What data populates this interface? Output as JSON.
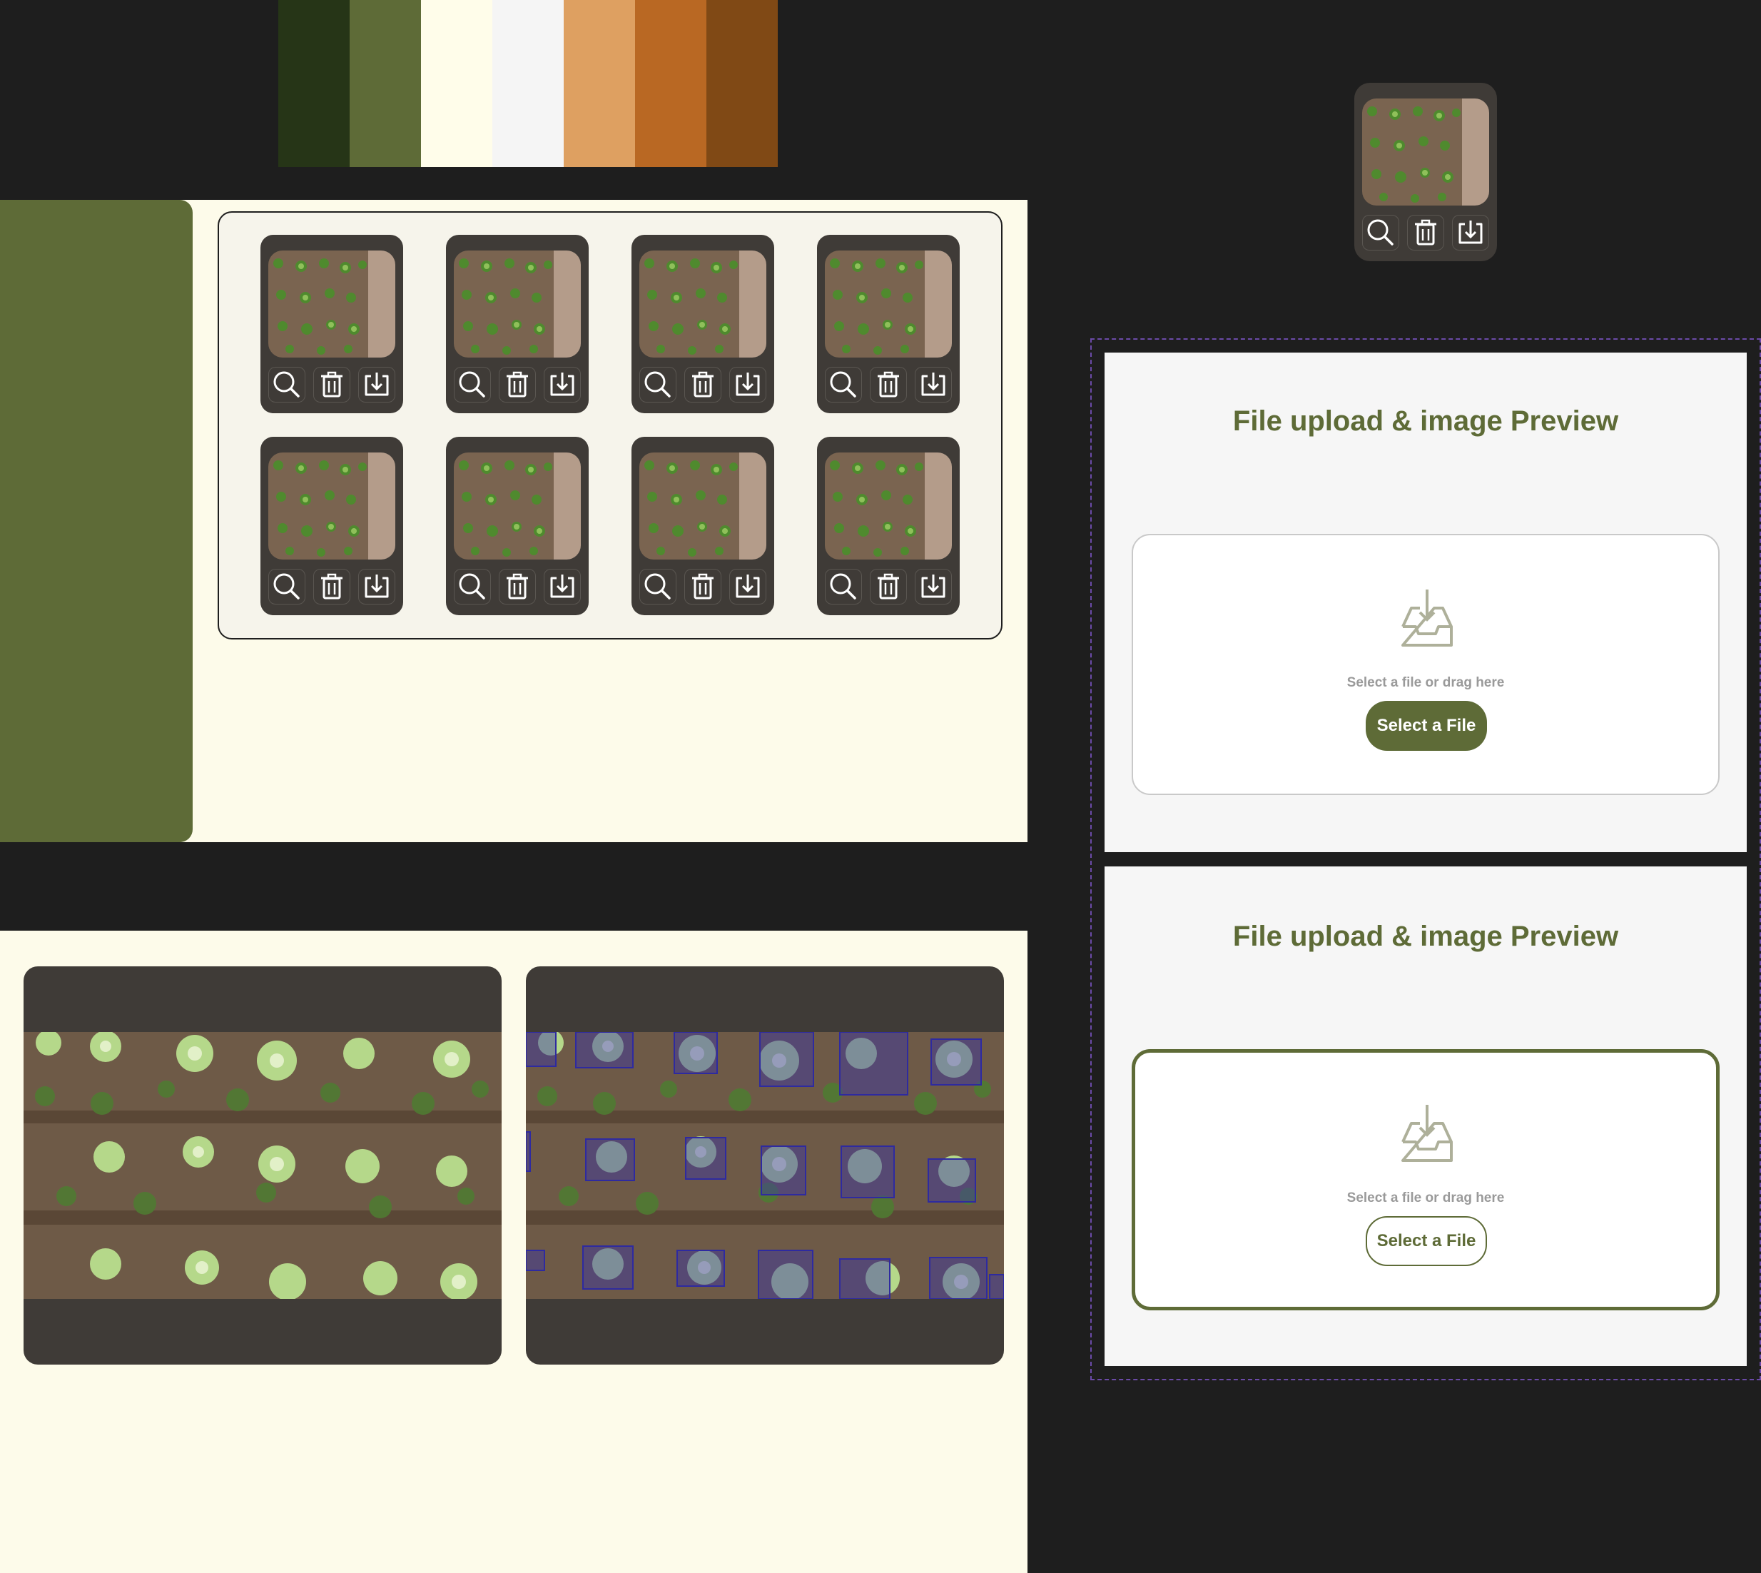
{
  "palette": {
    "colors": [
      "#263517",
      "#5e6b37",
      "#fffdea",
      "#f5f5f5",
      "#dea061",
      "#b96823",
      "#804915"
    ]
  },
  "gallery": {
    "item_count": 8,
    "actions": [
      "search-icon",
      "trash-icon",
      "download-icon"
    ]
  },
  "upload_panel_1": {
    "title": "File upload & image Preview",
    "hint": "Select a file or drag here",
    "button_label": "Select a File",
    "state": "default"
  },
  "upload_panel_2": {
    "title": "File upload & image Preview",
    "hint": "Select a file or drag here",
    "button_label": "Select a File",
    "state": "active"
  },
  "preview": {
    "original": "field-photo",
    "annotated": "field-photo-with-detections"
  },
  "theme": {
    "accent": "#5e6b37",
    "card_bg": "#3f3b37",
    "panel_bg": "#fdfbea",
    "detection_box": "#3a35a8"
  }
}
